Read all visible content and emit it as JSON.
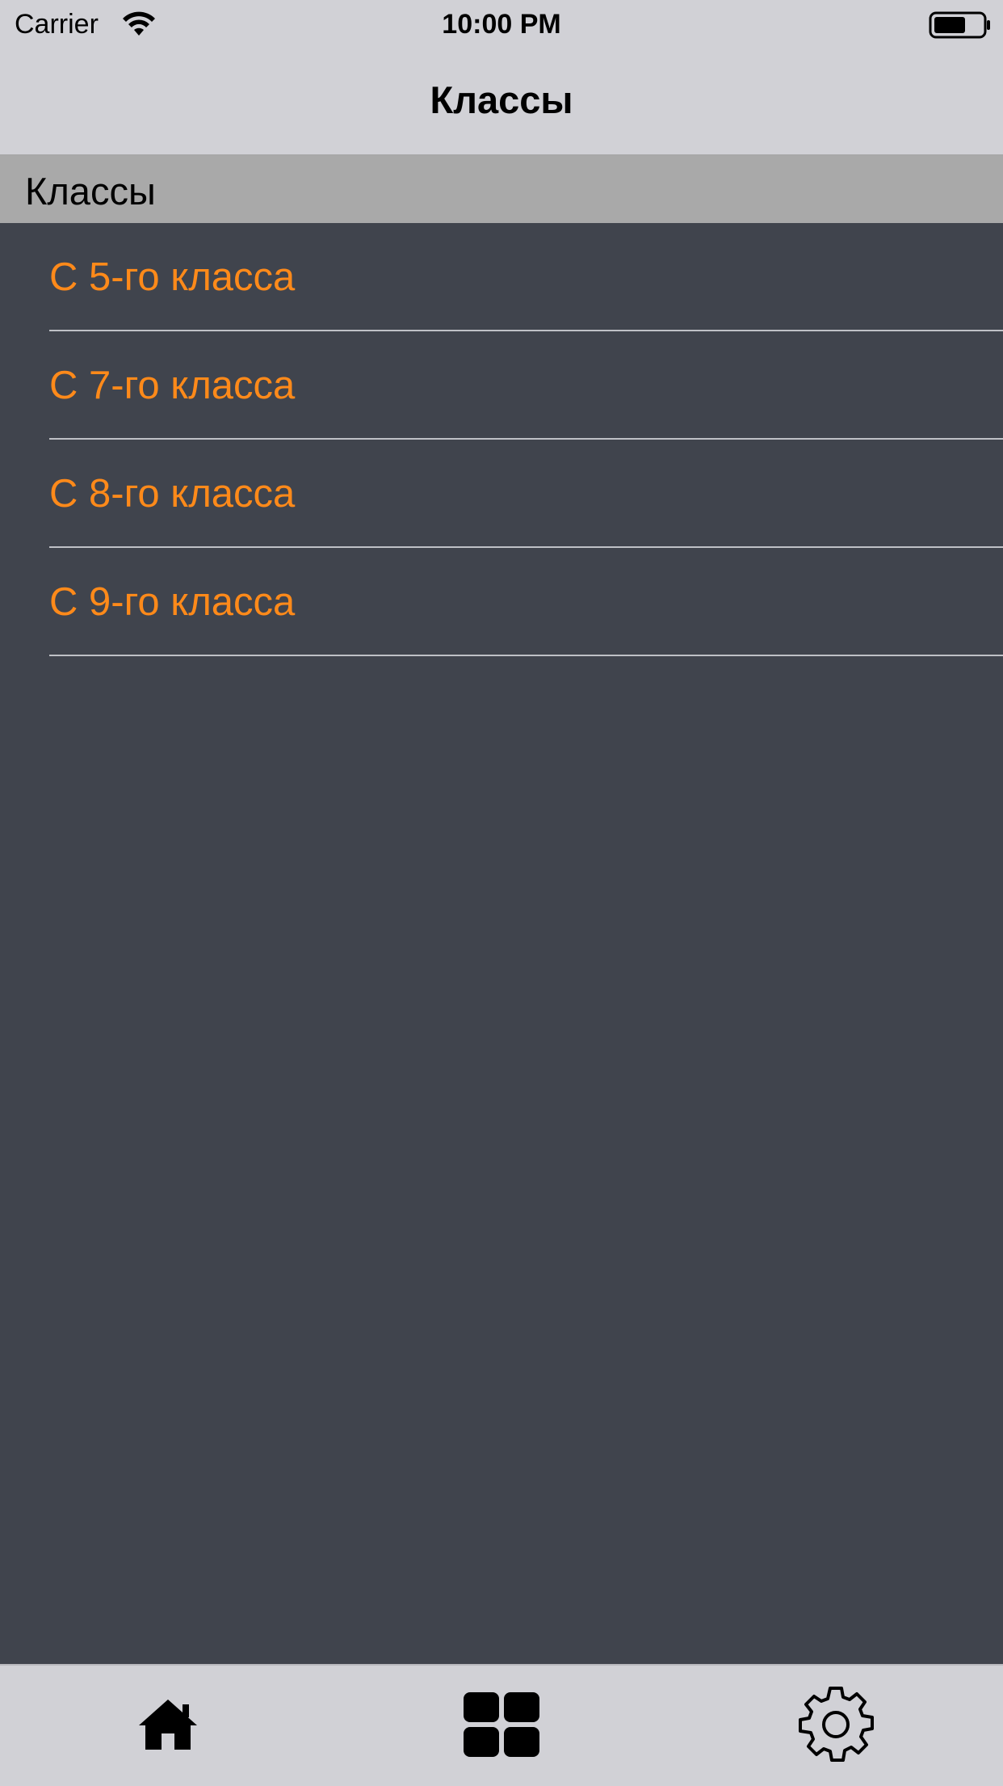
{
  "status_bar": {
    "carrier": "Carrier",
    "time": "10:00 PM",
    "icons": [
      "wifi-icon",
      "battery-icon"
    ]
  },
  "nav_bar": {
    "title": "Классы"
  },
  "section": {
    "header": "Классы",
    "items": [
      {
        "label": "С 5-го класса"
      },
      {
        "label": "С 7-го класса"
      },
      {
        "label": "С 8-го класса"
      },
      {
        "label": "С 9-го класса"
      }
    ]
  },
  "tab_bar": {
    "tabs": [
      {
        "icon": "home-icon"
      },
      {
        "icon": "grid-icon"
      },
      {
        "icon": "gear-icon"
      }
    ]
  },
  "colors": {
    "list_background": "#40444d",
    "item_text": "#ff8a1a",
    "bars": "#d1d1d6",
    "section_header": "#a9a9a9"
  }
}
